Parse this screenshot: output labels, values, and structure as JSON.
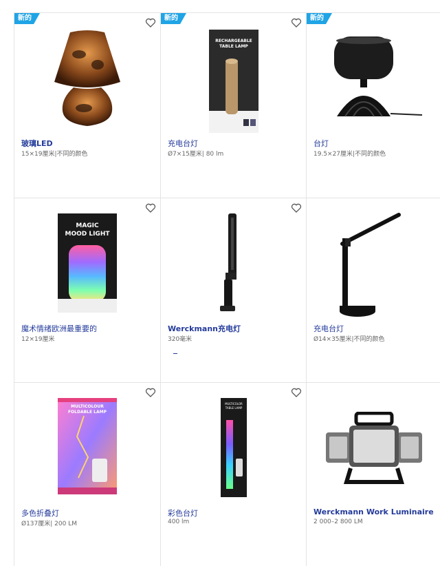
{
  "products": [
    {
      "badge": "新的",
      "title": "玻璃LED",
      "subtitle": "15×19厘米|不同的颜色",
      "image": "glass-mushroom-lamp"
    },
    {
      "badge": "新的",
      "title": "充电台灯",
      "subtitle": "Ø7×15厘米| 80 lm",
      "image": "rechargeable-table-lamp-box"
    },
    {
      "badge": "新的",
      "title": "台灯",
      "subtitle": "19.5×27厘米|不同的颜色",
      "image": "black-shade-lamp"
    },
    {
      "badge": "",
      "title": "魔术情绪欧洲最重要的",
      "subtitle": "12×19厘米",
      "image": "magic-mood-light-box"
    },
    {
      "badge": "",
      "title": "Werckmann充电灯",
      "subtitle": "320毫米",
      "image": "work-light-stick"
    },
    {
      "badge": "",
      "title": "充电台灯",
      "subtitle": "Ø14×35厘米|不同的颜色",
      "image": "black-arm-desk-lamp"
    },
    {
      "badge": "",
      "title": "多色折叠灯",
      "subtitle": "Ø137厘米| 200 LM",
      "image": "multicolour-foldable-lamp-box"
    },
    {
      "badge": "",
      "title": "彩色台灯",
      "subtitle": "400 lm",
      "image": "multicolor-table-lamp-box"
    },
    {
      "badge": "",
      "title": "Werckmann Work Luminaire",
      "subtitle": "2 000–2 800 LM",
      "image": "work-floodlight"
    }
  ],
  "box_text": {
    "p2": [
      "RECHARGEABLE",
      "TABLE LAMP"
    ],
    "p4": [
      "MAGIC",
      "MOOD LIGHT"
    ],
    "p7": [
      "MULTICOLOUR",
      "FOLDABLE LAMP"
    ],
    "p8": [
      "MULTICOLOR",
      "TABLE LAMP"
    ]
  },
  "colors": {
    "accent": "#1fa4e6",
    "title": "#243b9b"
  }
}
